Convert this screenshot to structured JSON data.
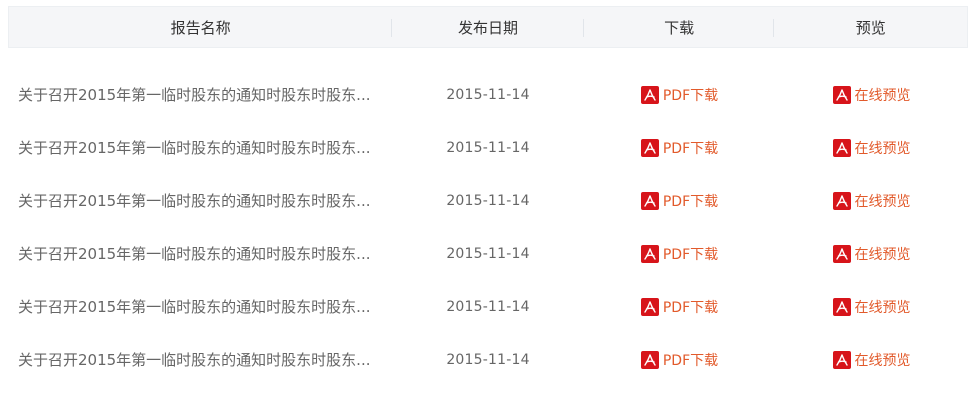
{
  "table": {
    "headers": {
      "name": "报告名称",
      "date": "发布日期",
      "download": "下载",
      "preview": "预览"
    },
    "rows": [
      {
        "title": "关于召开2015年第一临时股东的通知时股东时股东...",
        "date": "2015-11-14",
        "download": "PDF下载",
        "preview": "在线预览"
      },
      {
        "title": "关于召开2015年第一临时股东的通知时股东时股东...",
        "date": "2015-11-14",
        "download": "PDF下载",
        "preview": "在线预览"
      },
      {
        "title": "关于召开2015年第一临时股东的通知时股东时股东...",
        "date": "2015-11-14",
        "download": "PDF下载",
        "preview": "在线预览"
      },
      {
        "title": "关于召开2015年第一临时股东的通知时股东时股东...",
        "date": "2015-11-14",
        "download": "PDF下载",
        "preview": "在线预览"
      },
      {
        "title": "关于召开2015年第一临时股东的通知时股东时股东...",
        "date": "2015-11-14",
        "download": "PDF下载",
        "preview": "在线预览"
      },
      {
        "title": "关于召开2015年第一临时股东的通知时股东时股东...",
        "date": "2015-11-14",
        "download": "PDF下载",
        "preview": "在线预览"
      }
    ]
  },
  "icons": {
    "download_icon": "pdf-icon",
    "preview_icon": "pdf-icon"
  },
  "colors": {
    "link": "#e25a2b",
    "pdf_icon": "#d7141a",
    "header_bg": "#f5f6f8"
  }
}
